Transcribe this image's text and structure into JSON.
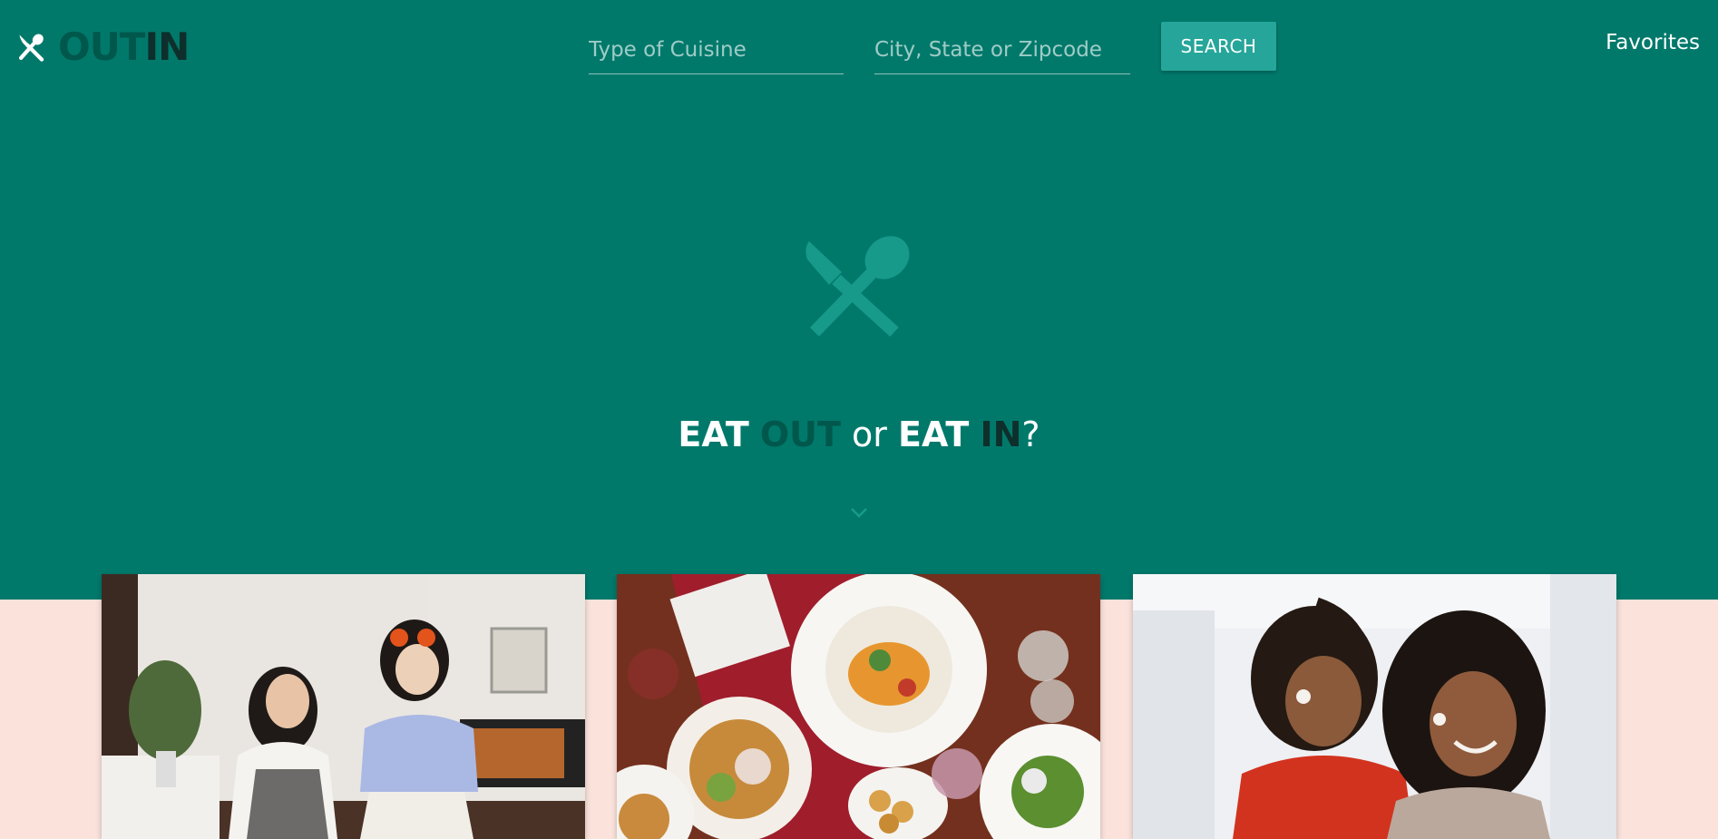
{
  "brand": {
    "icon": "utensils-icon",
    "name_out": "OUT",
    "name_in": "IN"
  },
  "search": {
    "cuisine_placeholder": "Type of Cuisine",
    "cuisine_value": "",
    "location_placeholder": "City, State or Zipcode",
    "location_value": "",
    "button_label": "SEARCH"
  },
  "nav": {
    "favorites_label": "Favorites"
  },
  "hero": {
    "icon": "utensils-icon",
    "tagline": {
      "eat1": "EAT",
      "out": "OUT",
      "or": "or",
      "eat2": "EAT",
      "in": "IN",
      "qmark": "?"
    },
    "scroll_icon": "chevron-down-icon"
  },
  "cards": [
    {
      "image": "two women cooking in a kitchen"
    },
    {
      "image": "restaurant table with plates of food"
    },
    {
      "image": "mother and daughter baking together"
    }
  ],
  "colors": {
    "hero_bg": "#00796b",
    "accent": "#26a69a",
    "dark_teal": "#00574b",
    "page_bg": "#fbe3dc"
  }
}
